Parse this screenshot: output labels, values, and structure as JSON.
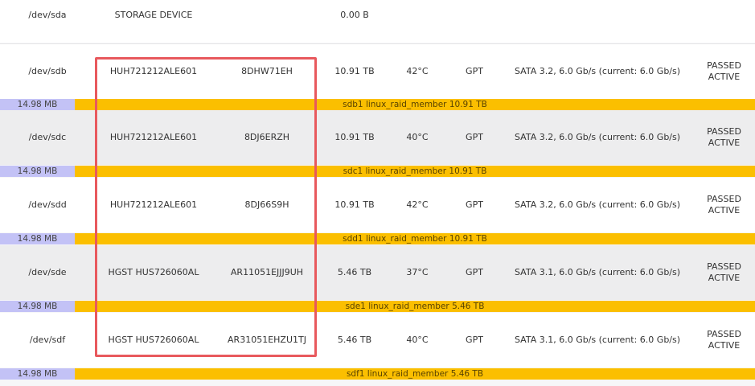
{
  "colors": {
    "partition_bar": "#fbbf00",
    "partition_size": "#c3c2f6",
    "highlight_border": "#e8595d"
  },
  "top_row": {
    "device": "/dev/sda",
    "model": "STORAGE DEVICE",
    "capacity": "0.00 B"
  },
  "disks": [
    {
      "device": "/dev/sdb",
      "model": "HUH721212ALE601",
      "serial": "8DHW71EH",
      "capacity": "10.91 TB",
      "temp": "42°C",
      "table": "GPT",
      "interface": "SATA 3.2, 6.0 Gb/s (current: 6.0 Gb/s)",
      "status1": "PASSED",
      "status2": "ACTIVE",
      "partition_size": "14.98 MB",
      "partition_label": "sdb1 linux_raid_member 10.91 TB"
    },
    {
      "device": "/dev/sdc",
      "model": "HUH721212ALE601",
      "serial": "8DJ6ERZH",
      "capacity": "10.91 TB",
      "temp": "40°C",
      "table": "GPT",
      "interface": "SATA 3.2, 6.0 Gb/s (current: 6.0 Gb/s)",
      "status1": "PASSED",
      "status2": "ACTIVE",
      "partition_size": "14.98 MB",
      "partition_label": "sdc1 linux_raid_member 10.91 TB"
    },
    {
      "device": "/dev/sdd",
      "model": "HUH721212ALE601",
      "serial": "8DJ66S9H",
      "capacity": "10.91 TB",
      "temp": "42°C",
      "table": "GPT",
      "interface": "SATA 3.2, 6.0 Gb/s (current: 6.0 Gb/s)",
      "status1": "PASSED",
      "status2": "ACTIVE",
      "partition_size": "14.98 MB",
      "partition_label": "sdd1 linux_raid_member 10.91 TB"
    },
    {
      "device": "/dev/sde",
      "model": "HGST HUS726060AL",
      "serial": "AR11051EJJJ9UH",
      "capacity": "5.46 TB",
      "temp": "37°C",
      "table": "GPT",
      "interface": "SATA 3.1, 6.0 Gb/s (current: 6.0 Gb/s)",
      "status1": "PASSED",
      "status2": "ACTIVE",
      "partition_size": "14.98 MB",
      "partition_label": "sde1 linux_raid_member 5.46 TB"
    },
    {
      "device": "/dev/sdf",
      "model": "HGST HUS726060AL",
      "serial": "AR31051EHZU1TJ",
      "capacity": "5.46 TB",
      "temp": "40°C",
      "table": "GPT",
      "interface": "SATA 3.1, 6.0 Gb/s (current: 6.0 Gb/s)",
      "status1": "PASSED",
      "status2": "ACTIVE",
      "partition_size": "14.98 MB",
      "partition_label": "sdf1 linux_raid_member 5.46 TB"
    }
  ]
}
